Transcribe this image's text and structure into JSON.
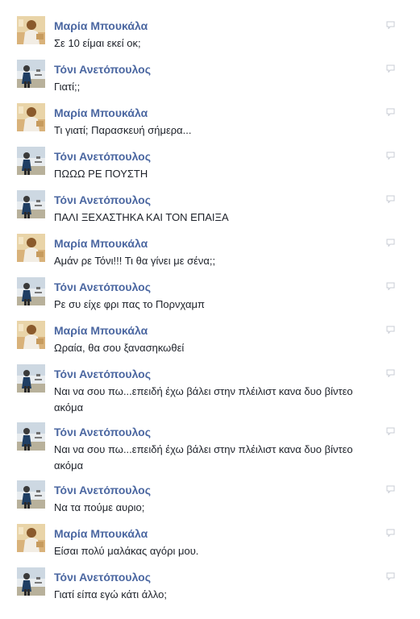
{
  "messages": [
    {
      "author": "Μαρία Μπουκάλα",
      "avatar": "maria",
      "text": "Σε 10 είμαι εκεί οκ;"
    },
    {
      "author": "Τόνι Ανετόπουλος",
      "avatar": "toni",
      "text": "Γιατί;;"
    },
    {
      "author": "Μαρία Μπουκάλα",
      "avatar": "maria",
      "text": "Τι γιατί; Παρασκευή σήμερα..."
    },
    {
      "author": "Τόνι Ανετόπουλος",
      "avatar": "toni",
      "text": "ΠΩΩΩ ΡΕ ΠΟΥΣΤΗ"
    },
    {
      "author": "Τόνι Ανετόπουλος",
      "avatar": "toni",
      "text": "ΠΑΛΙ ΞΕΧΑΣΤΗΚΑ ΚΑΙ ΤΟΝ ΕΠΑΙΞΑ"
    },
    {
      "author": "Μαρία Μπουκάλα",
      "avatar": "maria",
      "text": "Αμάν ρε Τόνι!!! Τι θα γίνει με σένα;;"
    },
    {
      "author": "Τόνι Ανετόπουλος",
      "avatar": "toni",
      "text": "Ρε συ είχε φρι πας το Πορνχαμπ"
    },
    {
      "author": "Μαρία Μπουκάλα",
      "avatar": "maria",
      "text": "Ωραία, θα σου ξανασηκωθεί"
    },
    {
      "author": "Τόνι Ανετόπουλος",
      "avatar": "toni",
      "text": "Ναι να σου πω...επειδή έχω βάλει στην πλέιλιστ κανα δυο βίντεο ακόμα",
      "tall": true
    },
    {
      "author": "Τόνι Ανετόπουλος",
      "avatar": "toni",
      "text": "Ναι να σου πω...επειδή έχω βάλει στην πλέιλιστ κανα δυο βίντεο ακόμα",
      "tall": true
    },
    {
      "author": "Τόνι Ανετόπουλος",
      "avatar": "toni",
      "text": "Να τα πούμε αυριο;"
    },
    {
      "author": "Μαρία Μπουκάλα",
      "avatar": "maria",
      "text": "Είσαι πολύ μαλάκας αγόρι μου."
    },
    {
      "author": "Τόνι Ανετόπουλος",
      "avatar": "toni",
      "text": "Γιατί είπα εγώ κάτι άλλο;"
    }
  ],
  "colors": {
    "name": "#4b67a1",
    "text": "#1d2129",
    "icon": "#c8ccd4"
  },
  "icons": {
    "reply": "speech-bubble-icon"
  }
}
